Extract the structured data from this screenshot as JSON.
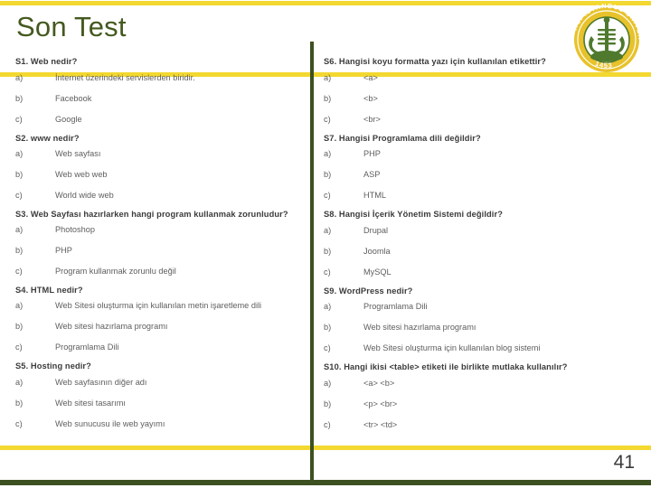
{
  "slide": {
    "title": "Son Test",
    "page_number": "41",
    "accent_yellow": "#F2D830",
    "accent_green": "#3D5021",
    "title_color": "#44591F",
    "question_color": "#3B3B3B",
    "option_color": "#5E5E5E"
  },
  "logo": {
    "name": "istanbul-universitesi-seal",
    "outer_text": "T.C. İSTANBUL ÜNİVERSİTESİ",
    "year": "1453",
    "ring_color": "#E8C22B",
    "emblem_color": "#4F7A2E"
  },
  "left_column": [
    {
      "question": "S1. Web nedir?",
      "options": [
        {
          "marker": "a)",
          "text": "İnternet üzerindeki servislerden biridir."
        },
        {
          "marker": "b)",
          "text": "Facebook"
        },
        {
          "marker": "c)",
          "text": "Google"
        }
      ]
    },
    {
      "question": "S2. www nedir?",
      "options": [
        {
          "marker": "a)",
          "text": "Web sayfası"
        },
        {
          "marker": "b)",
          "text": "Web web web"
        },
        {
          "marker": "c)",
          "text": "World wide web"
        }
      ]
    },
    {
      "question": "S3. Web Sayfası hazırlarken hangi program kullanmak zorunludur?",
      "options": [
        {
          "marker": "a)",
          "text": "Photoshop"
        },
        {
          "marker": "b)",
          "text": "PHP"
        },
        {
          "marker": "c)",
          "text": "Program kullanmak zorunlu değil"
        }
      ]
    },
    {
      "question": "S4. HTML nedir?",
      "options": [
        {
          "marker": "a)",
          "text": "Web Sitesi oluşturma için kullanılan metin işaretleme dili"
        },
        {
          "marker": "b)",
          "text": "Web sitesi hazırlama programı"
        },
        {
          "marker": "c)",
          "text": "Programlama Dili"
        }
      ]
    },
    {
      "question": "S5. Hosting nedir?",
      "options": [
        {
          "marker": "a)",
          "text": "Web sayfasının diğer adı"
        },
        {
          "marker": "b)",
          "text": "Web sitesi tasarımı"
        },
        {
          "marker": "c)",
          "text": "Web sunucusu ile web yayımı"
        }
      ]
    }
  ],
  "right_column": [
    {
      "question": "S6. Hangisi koyu formatta yazı için kullanılan etikettir?",
      "options": [
        {
          "marker": "a)",
          "text": "<a>"
        },
        {
          "marker": "b)",
          "text": "<b>"
        },
        {
          "marker": "c)",
          "text": "<br>"
        }
      ]
    },
    {
      "question": "S7. Hangisi Programlama dili değildir?",
      "options": [
        {
          "marker": "a)",
          "text": "PHP"
        },
        {
          "marker": "b)",
          "text": "ASP"
        },
        {
          "marker": "c)",
          "text": "HTML"
        }
      ]
    },
    {
      "question": "S8. Hangisi İçerik Yönetim Sistemi değildir?",
      "options": [
        {
          "marker": "a)",
          "text": "Drupal"
        },
        {
          "marker": "b)",
          "text": "Joomla"
        },
        {
          "marker": "c)",
          "text": "MySQL"
        }
      ]
    },
    {
      "question": "S9. WordPress nedir?",
      "options": [
        {
          "marker": "a)",
          "text": "Programlama Dili"
        },
        {
          "marker": "b)",
          "text": "Web sitesi hazırlama programı"
        },
        {
          "marker": "c)",
          "text": "Web Sitesi oluşturma için kullanılan blog sistemi"
        }
      ]
    },
    {
      "question": "S10. Hangi ikisi <table> etiketi ile birlikte mutlaka kullanılır?",
      "options": [
        {
          "marker": "a)",
          "text": "<a> <b>"
        },
        {
          "marker": "b)",
          "text": "<p> <br>"
        },
        {
          "marker": "c)",
          "text": "<tr> <td>"
        }
      ]
    }
  ]
}
